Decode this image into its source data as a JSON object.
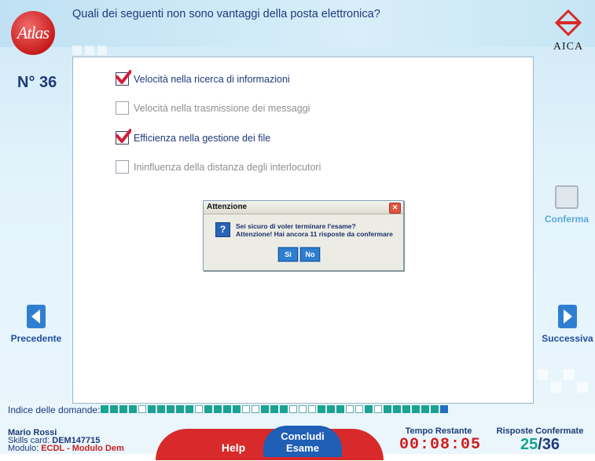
{
  "question": {
    "number": "N° 36",
    "text": "Quali dei seguenti non sono vantaggi della posta elettronica?",
    "options": [
      {
        "label": "Velocità nella ricerca di informazioni",
        "checked": true
      },
      {
        "label": "Velocità nella trasmissione dei messaggi",
        "checked": false
      },
      {
        "label": "Efficienza nella gestione dei file",
        "checked": true
      },
      {
        "label": "Ininfluenza della distanza degli interlocutori",
        "checked": false
      }
    ]
  },
  "logos": {
    "left": "Atlas",
    "right": "AICA"
  },
  "navigation": {
    "previous": "Precedente",
    "next": "Successiva",
    "confirm": "Conferma"
  },
  "dialog": {
    "title": "Attenzione",
    "line1": "Sei sicuro di voler terminare l'esame?",
    "line2": "Attenzione! Hai ancora 11 risposte da confermare",
    "yes": "Sì",
    "no": "No"
  },
  "index": {
    "label": "Indice delle domande:",
    "states": [
      "c",
      "c",
      "c",
      "c",
      "u",
      "c",
      "c",
      "c",
      "c",
      "c",
      "u",
      "c",
      "c",
      "c",
      "c",
      "u",
      "u",
      "c",
      "c",
      "c",
      "u",
      "u",
      "u",
      "c",
      "c",
      "c",
      "u",
      "u",
      "c",
      "u",
      "c",
      "c",
      "c",
      "c",
      "c",
      "c",
      "cur"
    ]
  },
  "footer": {
    "name": "Mario Rossi",
    "skills_label": "Skills card:",
    "skills_value": "DEM147715",
    "module_label": "Modulo:",
    "module_value": "ECDL - Modulo Dem",
    "help": "Help",
    "concludi_line1": "Concludi",
    "concludi_line2": "Esame",
    "time_label": "Tempo Restante",
    "time_value": "00:08:05",
    "answers_label": "Risposte Confermate",
    "answers_done": "25",
    "answers_sep": "/",
    "answers_total": "36"
  },
  "colors": {
    "accent_blue": "#1f3a7a",
    "check_red": "#d11d3a",
    "answered_green": "#1aa392",
    "time_red": "#d11d1d"
  }
}
